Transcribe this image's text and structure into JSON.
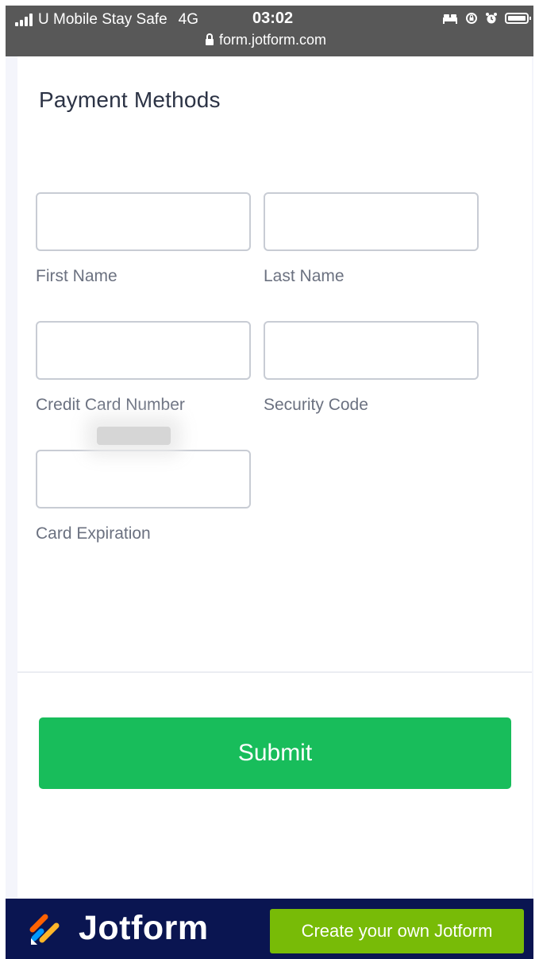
{
  "status_bar": {
    "carrier": "U Mobile Stay Safe",
    "network": "4G",
    "time": "03:02",
    "url": "form.jotform.com",
    "icons": [
      "signal-icon",
      "bed-icon",
      "rotation-lock-icon",
      "alarm-icon",
      "battery-icon"
    ]
  },
  "form": {
    "title": "Payment Methods",
    "fields": {
      "first_name": {
        "label": "First Name",
        "value": ""
      },
      "last_name": {
        "label": "Last Name",
        "value": ""
      },
      "card_number": {
        "label": "Credit Card Number",
        "value": ""
      },
      "security_code": {
        "label": "Security Code",
        "value": ""
      },
      "card_expiration": {
        "label": "Card Expiration",
        "value": ""
      }
    },
    "submit_label": "Submit"
  },
  "footer": {
    "brand": "Jotform",
    "cta_label": "Create your own Jotform"
  },
  "colors": {
    "submit": "#18bd5b",
    "footer_bg": "#0a1551",
    "cta": "#78bb07",
    "logo_orange": "#ff6100",
    "logo_blue": "#0099ff",
    "logo_yellow": "#ffb629"
  }
}
